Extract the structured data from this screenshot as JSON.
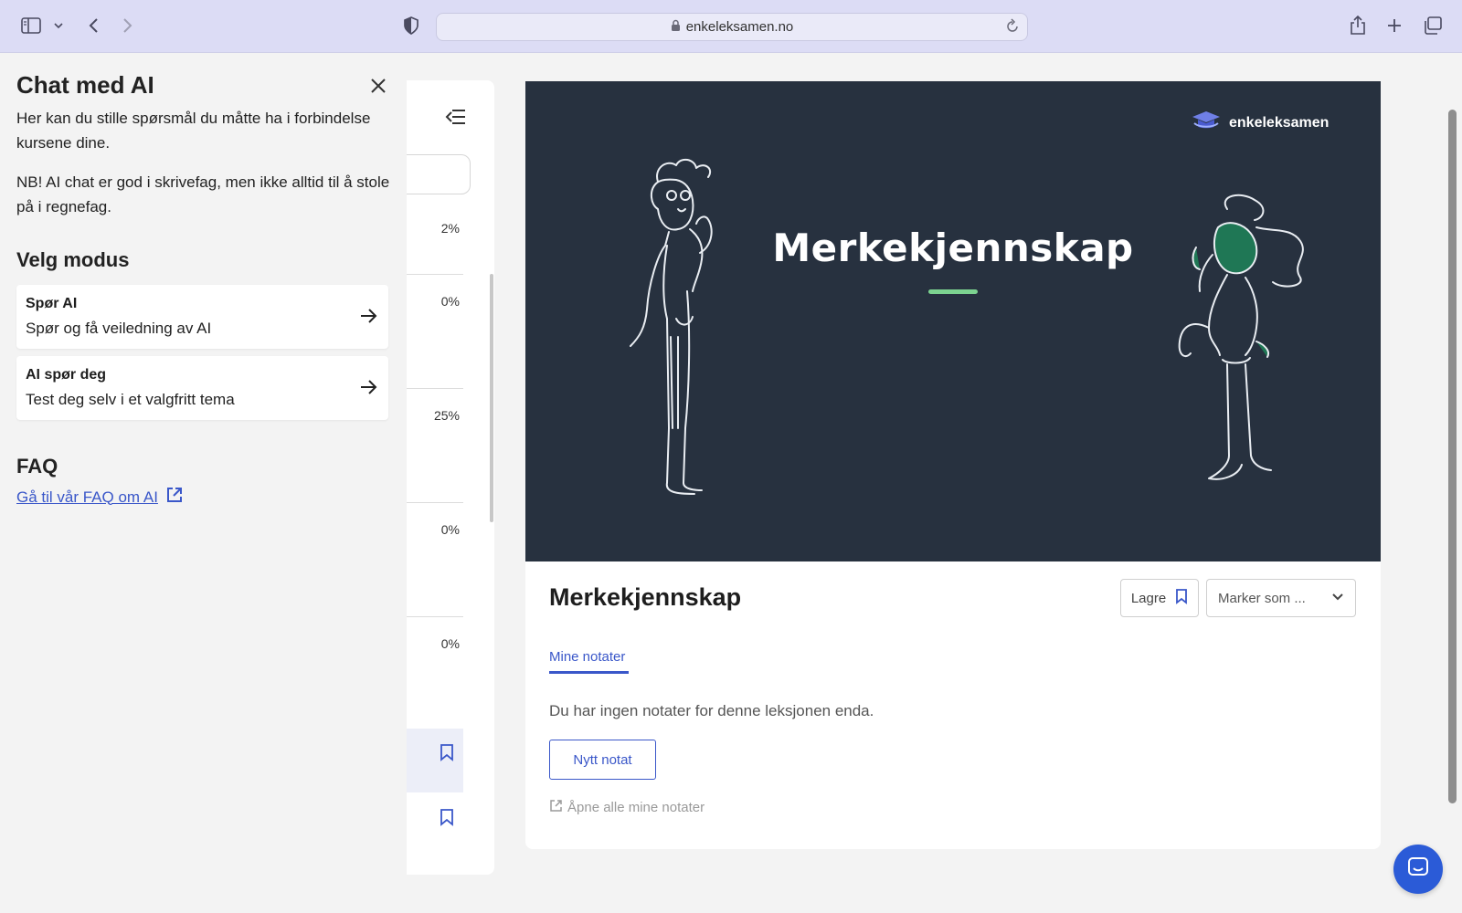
{
  "browser": {
    "url": "enkeleksamen.no",
    "icons": [
      "sidebar-icon",
      "chevron-down-icon",
      "back-icon",
      "forward-icon",
      "shield-icon",
      "lock-icon",
      "reload-icon",
      "share-icon",
      "plus-icon",
      "tabs-icon"
    ]
  },
  "ai_panel": {
    "title": "Chat med AI",
    "description": "Her kan du stille spørsmål du måtte ha i forbindelse kursene dine.",
    "note": "NB! AI chat er god i skrivefag, men ikke alltid til å stole på i regnefag.",
    "mode_heading": "Velg modus",
    "modes": [
      {
        "title": "Spør AI",
        "subtitle": "Spør og få veiledning av AI"
      },
      {
        "title": "AI spør deg",
        "subtitle": "Test deg selv i et valgfritt tema"
      }
    ],
    "faq_heading": "FAQ",
    "faq_link": "Gå til vår FAQ om AI"
  },
  "lesson_list": {
    "percentages": [
      "2%",
      "0%",
      "25%",
      "0%",
      "0%"
    ]
  },
  "hero": {
    "title": "Merkekjennskap",
    "logo_text": "enkeleksamen"
  },
  "lesson": {
    "title": "Merkekjennskap",
    "save_label": "Lagre",
    "mark_label": "Marker som ...",
    "tab_notes": "Mine notater",
    "empty_notes": "Du har ingen notater for denne leksjonen enda.",
    "new_note": "Nytt notat",
    "open_all": "Åpne alle mine notater"
  },
  "colors": {
    "accent": "#3a57c9",
    "hero_bg": "#27313f",
    "hero_accent": "#7cd390",
    "toolbar_bg": "#dcdcf5",
    "chat_fab": "#2b5bd7"
  }
}
